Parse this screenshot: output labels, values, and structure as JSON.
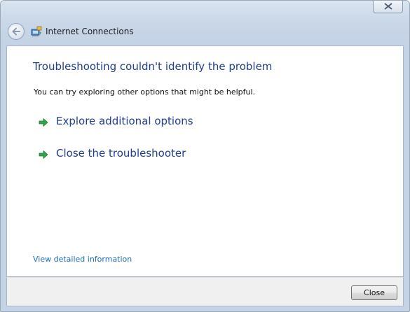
{
  "window": {
    "title": "Internet Connections",
    "close_icon": "close-x-icon",
    "back_icon": "back-arrow-icon",
    "app_icon": "network-troubleshooter-icon"
  },
  "content": {
    "heading": "Troubleshooting couldn't identify the problem",
    "subtext": "You can try exploring other options that might be helpful.",
    "options": [
      {
        "label": "Explore additional options",
        "icon": "green-arrow-icon"
      },
      {
        "label": "Close the troubleshooter",
        "icon": "green-arrow-icon"
      }
    ],
    "details_link": "View detailed information"
  },
  "footer": {
    "close_label": "Close"
  },
  "colors": {
    "heading": "#1f3f8f",
    "link": "#1b6fb8",
    "arrow": "#2ea64a"
  }
}
